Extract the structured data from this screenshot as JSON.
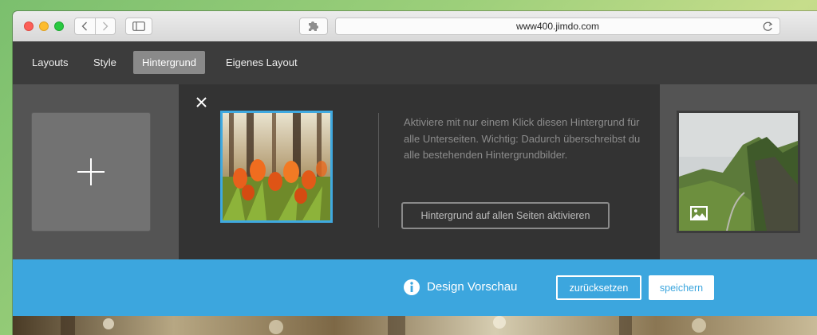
{
  "browser": {
    "url": "www400.jimdo.com",
    "icons": [
      "back-icon",
      "forward-icon",
      "sidebar-icon",
      "extension-icon",
      "reload-icon"
    ]
  },
  "editor": {
    "tabs": [
      {
        "label": "Layouts",
        "active": false
      },
      {
        "label": "Style",
        "active": false
      },
      {
        "label": "Hintergrund",
        "active": true
      },
      {
        "label": "Eigenes Layout",
        "active": false
      }
    ],
    "description": "Aktiviere mit nur einem Klick diesen Hintergrund für alle Unterseiten. Wichtig: Dadurch überschreibst du alle bestehenden Hintergrundbilder.",
    "activate_label": "Hintergrund auf allen Seiten aktivieren",
    "close_icon": "close-icon",
    "add_icon": "plus-icon"
  },
  "preview": {
    "label": "Design Vorschau",
    "reset_label": "zurücksetzen",
    "save_label": "speichern"
  },
  "colors": {
    "accent": "#3ca6de",
    "panel_dark": "#333333",
    "panel_mid": "#545454",
    "menu": "#3c3c3c"
  }
}
